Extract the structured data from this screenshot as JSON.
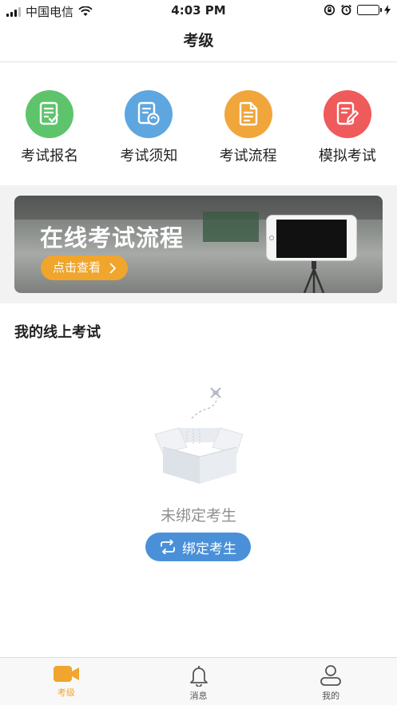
{
  "status_bar": {
    "carrier": "中国电信",
    "time": "4:03 PM",
    "battery_color": "#4cd964"
  },
  "nav": {
    "title": "考级"
  },
  "menu": [
    {
      "label": "考试报名",
      "color": "#5ec46c",
      "icon": "form-check-icon"
    },
    {
      "label": "考试须知",
      "color": "#5ea6e0",
      "icon": "notice-refresh-icon"
    },
    {
      "label": "考试流程",
      "color": "#f0a63a",
      "icon": "document-icon"
    },
    {
      "label": "模拟考试",
      "color": "#ef5a5a",
      "icon": "edit-document-icon"
    }
  ],
  "banner": {
    "title": "在线考试流程",
    "button_label": "点击查看"
  },
  "section": {
    "title": "我的线上考试"
  },
  "empty_state": {
    "message": "未绑定考生",
    "button_label": "绑定考生"
  },
  "tabs": [
    {
      "label": "考级",
      "icon": "video-camera-icon",
      "active": true
    },
    {
      "label": "消息",
      "icon": "bell-icon",
      "active": false
    },
    {
      "label": "我的",
      "icon": "user-icon",
      "active": false
    }
  ],
  "colors": {
    "accent": "#f0a52d",
    "primary_blue": "#4a90d9"
  }
}
